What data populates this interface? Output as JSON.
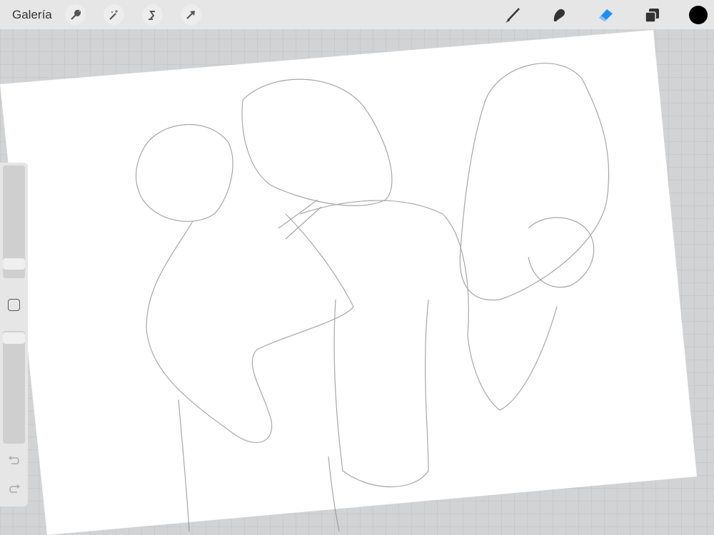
{
  "topbar": {
    "gallery_label": "Galería",
    "left_tools": [
      "wrench-icon",
      "magic-wand-icon",
      "selection-icon",
      "move-arrow-icon"
    ],
    "right_tools": [
      "brush-icon",
      "smudge-icon",
      "eraser-icon",
      "layers-icon",
      "color-swatch"
    ],
    "active_tool": "eraser",
    "accent_color": "#1e8ef5",
    "current_color": "#000000"
  },
  "sidebar": {
    "brush_size": 0.15,
    "opacity": 1.0,
    "buttons": [
      "modify-square",
      "undo",
      "redo"
    ]
  }
}
